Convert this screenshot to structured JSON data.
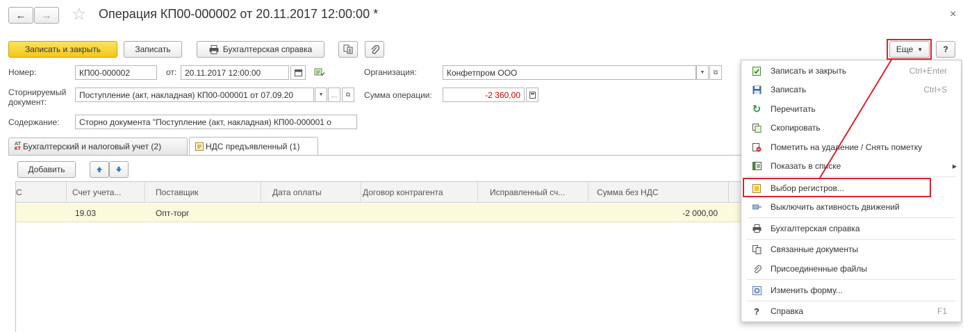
{
  "window": {
    "title": "Операция КП00-000002 от 20.11.2017 12:00:00 *",
    "back_glyph": "←",
    "forward_glyph": "→",
    "star_glyph": "☆",
    "close_glyph": "×"
  },
  "toolbar": {
    "save_close": "Записать и закрыть",
    "save": "Записать",
    "report": "Бухгалтерская справка",
    "more": "Еще",
    "help": "?"
  },
  "form": {
    "number_label": "Номер:",
    "number_value": "КП00-000002",
    "date_label": "от:",
    "date_value": "20.11.2017 12:00:00",
    "org_label": "Организация:",
    "org_value": "Конфетпром ООО",
    "storno_label_1": "Сторнируемый",
    "storno_label_2": "документ:",
    "storno_value": "Поступление (акт, накладная) КП00-000001 от 07.09.20",
    "sum_label": "Сумма операции:",
    "sum_value": "-2 360,00",
    "content_label": "Содержание:",
    "content_value": "Сторно документа \"Поступление (акт, накладная) КП00-000001 о"
  },
  "tabs": [
    {
      "label": "Бухгалтерский и налоговый учет (2)",
      "icon_top": "АТ",
      "icon_bottom": "КТ"
    },
    {
      "label": "НДС предъявленный (1)"
    }
  ],
  "table": {
    "add_label": "Добавить",
    "columns": [
      "С",
      "Счет учета...",
      "Поставщик",
      "Дата оплаты",
      "Договор контрагента",
      "Исправленный сч...",
      "Сумма без НДС",
      ""
    ],
    "rows": [
      {
        "account": "19.03",
        "supplier": "Опт-торг",
        "amount": "-2 000,00"
      }
    ]
  },
  "menu": {
    "items": [
      {
        "label": "Записать и закрыть",
        "shortcut": "Ctrl+Enter",
        "icon": "save-close-icon"
      },
      {
        "label": "Записать",
        "shortcut": "Ctrl+S",
        "icon": "floppy-icon"
      },
      {
        "label": "Перечитать",
        "icon": "refresh-icon"
      },
      {
        "label": "Скопировать",
        "icon": "copy-icon"
      },
      {
        "label": "Пометить на удаление / Снять пометку",
        "icon": "delete-mark-icon"
      },
      {
        "label": "Показать в списке",
        "icon": "list-icon"
      },
      {
        "label": "Выбор регистров...",
        "icon": "registers-icon"
      },
      {
        "label": "Выключить активность движений",
        "icon": "deactivate-icon"
      },
      {
        "label": "Бухгалтерская справка",
        "icon": "printer-icon"
      },
      {
        "label": "Связанные документы",
        "icon": "linked-docs-icon"
      },
      {
        "label": "Присоединенные файлы",
        "icon": "paperclip-icon"
      },
      {
        "label": "Изменить форму...",
        "icon": "form-settings-icon"
      },
      {
        "label": "Справка",
        "shortcut": "F1",
        "icon": "help-icon"
      }
    ],
    "help_glyph": "?",
    "submenu_arrow": "▶"
  },
  "colors": {
    "highlight": "#d62430",
    "primary_button": "#f4cc22",
    "row_selected": "#fcf9dc",
    "negative_value": "#c00000"
  }
}
